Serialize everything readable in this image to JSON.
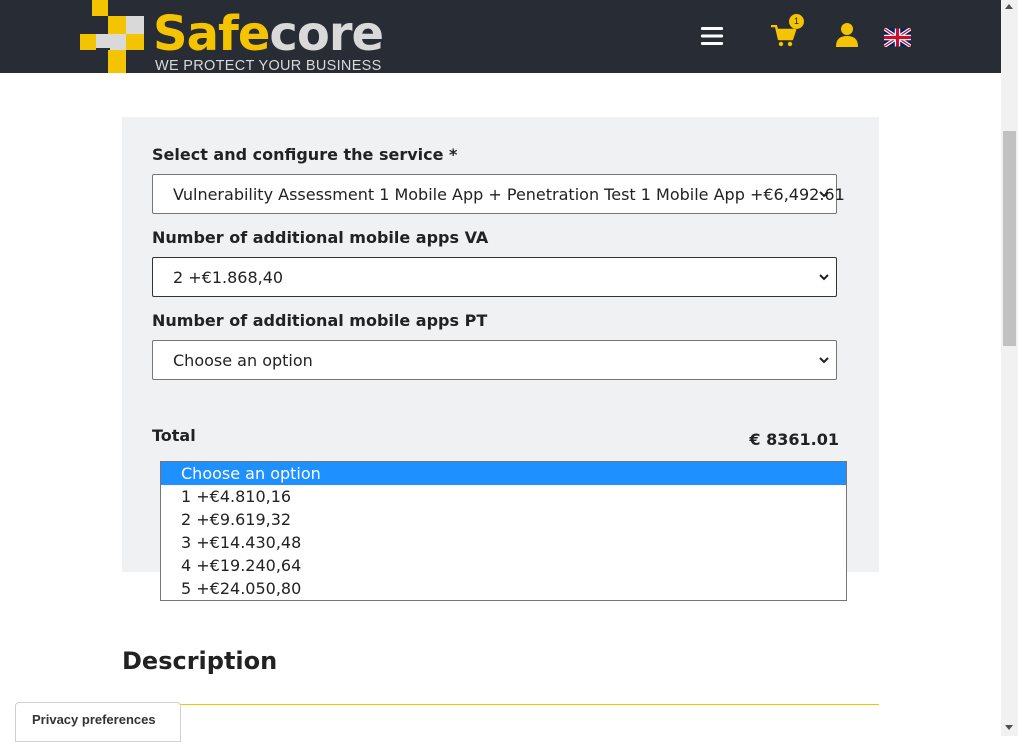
{
  "header": {
    "brand_part1": "Safe",
    "brand_part2": "core",
    "tagline": "WE PROTECT YOUR BUSINESS",
    "cart_count": "1",
    "icons": [
      "menu-icon",
      "cart-icon",
      "user-icon",
      "uk-flag-icon"
    ],
    "bg_color": "#282c34",
    "accent_color": "#f5c400"
  },
  "form": {
    "service_label": "Select and configure the service *",
    "service_value": "Vulnerability Assessment 1 Mobile App + Penetration Test 1 Mobile App +€6,492.61",
    "va_label": "Number of additional mobile apps VA",
    "va_value": "2 +€1.868,40",
    "pt_label": "Number of additional mobile apps PT",
    "pt_value": "Choose an option",
    "total_label": "Total",
    "total_value": "€ 8361.01"
  },
  "dropdown": {
    "selected_index": 0,
    "options": [
      "Choose an option",
      "1 +€4.810,16",
      "2 +€9.619,32",
      "3 +€14.430,48",
      "4 +€19.240,64",
      "5 +€24.050,80"
    ],
    "highlight_color": "#1e90ff"
  },
  "content": {
    "description_heading": "Description"
  },
  "privacy": {
    "label": "Privacy preferences"
  }
}
